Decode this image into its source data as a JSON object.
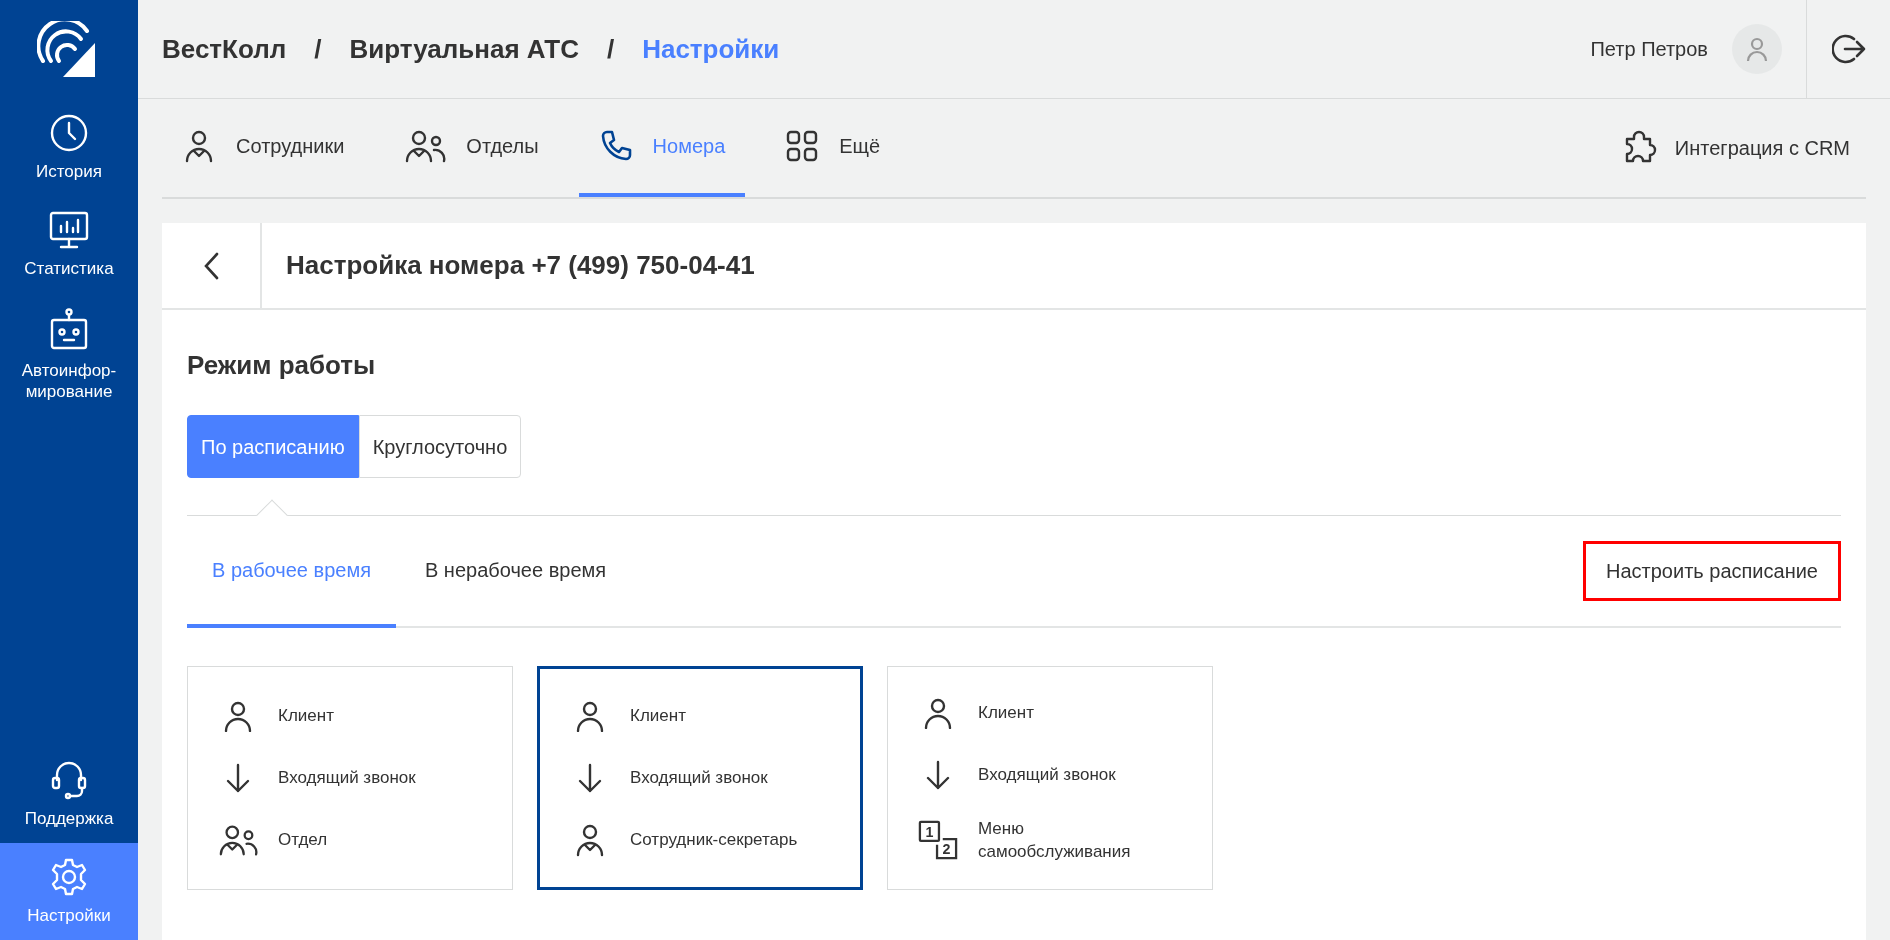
{
  "sidebar": {
    "items": [
      {
        "kind": "history",
        "label": "История",
        "selected": false
      },
      {
        "kind": "stats",
        "label": "Статистика",
        "selected": false
      },
      {
        "kind": "robot",
        "label": "Автоинфор-\nмирование",
        "selected": false
      }
    ],
    "bottom_items": [
      {
        "kind": "support",
        "label": "Поддержка",
        "selected": false
      },
      {
        "kind": "settings",
        "label": "Настройки",
        "selected": true
      }
    ]
  },
  "breadcrumbs": [
    {
      "label": "ВестКолл",
      "current": false
    },
    {
      "label": "Виртуальная АТС",
      "current": false
    },
    {
      "label": "Настройки",
      "current": true
    }
  ],
  "breadcrumb_separator": "/",
  "user": {
    "name": "Петр Петров"
  },
  "nav_tabs": [
    {
      "kind": "employee",
      "label": "Сотрудники",
      "selected": false
    },
    {
      "kind": "group",
      "label": "Отделы",
      "selected": false
    },
    {
      "kind": "phone",
      "label": "Номера",
      "selected": true
    },
    {
      "kind": "grid",
      "label": "Ещё",
      "selected": false
    }
  ],
  "crm_link": {
    "label": "Интеграция с CRM"
  },
  "panel": {
    "title": "Настройка номера +7 (499) 750-04-41",
    "section_title": "Режим работы",
    "mode_options": [
      {
        "label": "По расписанию",
        "selected": true
      },
      {
        "label": "Круглосуточно",
        "selected": false
      }
    ],
    "time_tabs": [
      {
        "label": "В рабочее время",
        "selected": true
      },
      {
        "label": "В нерабочее время",
        "selected": false
      }
    ],
    "schedule_button": {
      "label": "Настроить расписание",
      "highlighted": true
    },
    "scenarios": [
      {
        "selected": false,
        "steps": [
          {
            "kind": "person",
            "label": "Клиент"
          },
          {
            "kind": "arrow",
            "label": "Входящий звонок"
          },
          {
            "kind": "group",
            "label": "Отдел"
          }
        ]
      },
      {
        "selected": true,
        "steps": [
          {
            "kind": "person",
            "label": "Клиент"
          },
          {
            "kind": "arrow",
            "label": "Входящий звонок"
          },
          {
            "kind": "employee",
            "label": "Сотрудник-секретарь"
          }
        ]
      },
      {
        "selected": false,
        "steps": [
          {
            "kind": "person",
            "label": "Клиент"
          },
          {
            "kind": "arrow",
            "label": "Входящий звонок"
          },
          {
            "kind": "menu",
            "label": "Меню\nсамообслуживания",
            "digits": [
              "1",
              "2"
            ]
          }
        ]
      }
    ]
  }
}
